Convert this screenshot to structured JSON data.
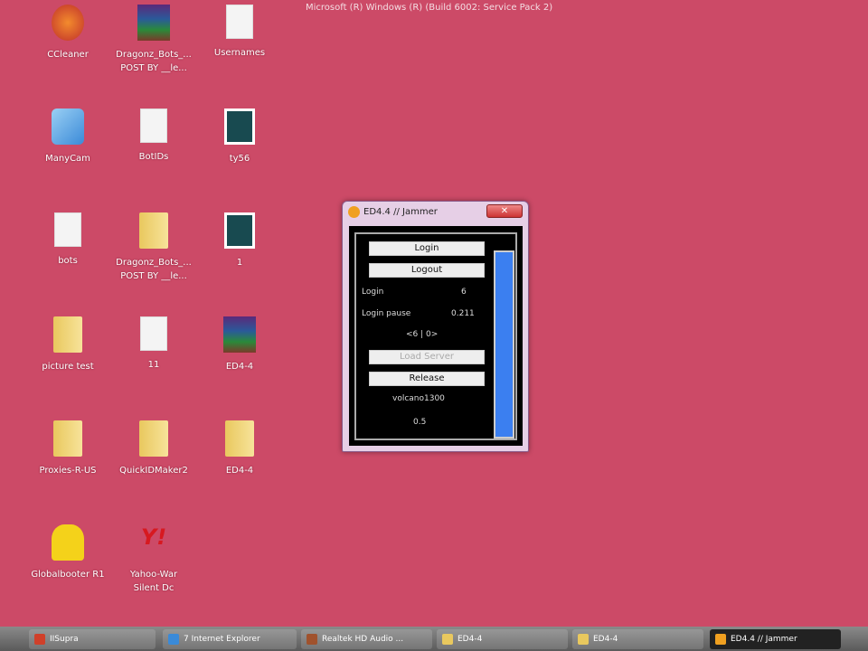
{
  "os_banner": "Microsoft (R) Windows (R) (Build 6002: Service Pack 2)",
  "desktop_icons": [
    {
      "label": "CCleaner",
      "type": "app"
    },
    {
      "label": "Dragonz_Bots_...\nPOST BY __le...",
      "type": "rar"
    },
    {
      "label": "Usernames",
      "type": "doc"
    },
    {
      "label": "ManyCam",
      "type": "cam"
    },
    {
      "label": "BotIDs",
      "type": "doc"
    },
    {
      "label": "ty56",
      "type": "img"
    },
    {
      "label": "bots",
      "type": "doc"
    },
    {
      "label": "Dragonz_Bots_...\nPOST BY __le...",
      "type": "folder"
    },
    {
      "label": "1",
      "type": "img"
    },
    {
      "label": "picture test",
      "type": "folder"
    },
    {
      "label": "11",
      "type": "doc"
    },
    {
      "label": "ED4-4",
      "type": "rar"
    },
    {
      "label": "Proxies-R-US",
      "type": "folder"
    },
    {
      "label": "QuickIDMaker2",
      "type": "folder"
    },
    {
      "label": "ED4-4",
      "type": "folder"
    },
    {
      "label": "Globalbooter R1",
      "type": "bart"
    },
    {
      "label": "Yahoo-War\nSilent Dc",
      "type": "yahoo"
    }
  ],
  "window": {
    "title": "ED4.4 // Jammer",
    "close": "✕",
    "login_button": "Login",
    "logout_button": "Logout",
    "login_label": "Login",
    "login_value": "6",
    "pause_label": "Login pause",
    "pause_value": "0.211",
    "counter": "<6 | 0>",
    "load_server_button": "Load Server",
    "release_button": "Release",
    "server_field": "volcano1300",
    "value_field": "0.5",
    "progress": 1.0
  },
  "taskbar": [
    {
      "label": "IISupra",
      "color": "#d0402a"
    },
    {
      "label": "7 Internet Explorer",
      "color": "#3a8ad8"
    },
    {
      "label": "Realtek HD Audio ...",
      "color": "#a0522d"
    },
    {
      "label": "ED4-4",
      "color": "#e9c85e"
    },
    {
      "label": "ED4-4",
      "color": "#e9c85e"
    },
    {
      "label": "ED4.4 // Jammer",
      "color": "#f0a020"
    }
  ]
}
